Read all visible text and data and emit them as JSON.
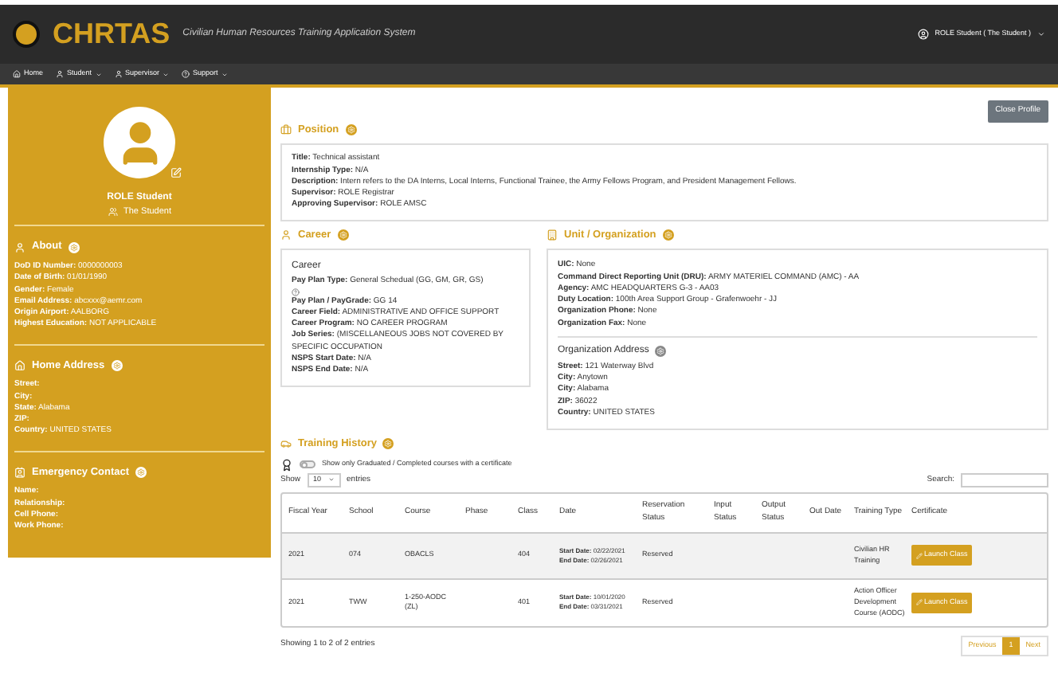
{
  "header": {
    "logo": "CHRTAS",
    "subtitle": "Civilian Human Resources Training Application System",
    "user": "ROLE Student ( The Student )"
  },
  "nav": [
    {
      "label": "Home",
      "kind": "link"
    },
    {
      "label": "Student",
      "kind": "menu"
    },
    {
      "label": "Supervisor",
      "kind": "menu"
    },
    {
      "label": "Support",
      "kind": "menu"
    }
  ],
  "profile": {
    "name": "ROLE Student",
    "role": "The Student"
  },
  "sidebar_sections": [
    {
      "title": "About",
      "fields": [
        [
          "DoD ID Number:",
          "0000000003"
        ],
        [
          "Date of Birth:",
          "01/01/1990"
        ],
        [
          "Gender:",
          "Female"
        ],
        [
          "Email Address:",
          "abcxxx@aemr.com"
        ],
        [
          "Origin Airport:",
          "AALBORG"
        ],
        [
          "Highest Education:",
          "NOT APPLICABLE"
        ]
      ]
    },
    {
      "title": "Home Address",
      "fields": [
        [
          "Street:"
        ],
        [
          "City:"
        ],
        [
          "State:",
          "Alabama"
        ],
        [
          "ZIP:"
        ],
        [
          "Country:",
          "UNITED STATES"
        ]
      ]
    },
    {
      "title": "Emergency Contact",
      "fields": [
        [
          "Name:"
        ],
        [
          "Relationship:"
        ],
        [
          "Cell Phone:"
        ],
        [
          "Work Phone:"
        ]
      ]
    }
  ],
  "close_button": "Close Profile",
  "position": {
    "title": "Position",
    "fields": [
      [
        "Title:",
        "Technical assistant"
      ],
      [
        "Internship Type:",
        "N/A"
      ],
      [
        "Description:",
        "Intern refers to the DA Interns, Local Interns, Functional Trainee, the Army Fellows Program, and President Management Fellows."
      ],
      [
        "Supervisor:",
        "ROLE Registrar"
      ],
      [
        "Approving Supervisor:",
        "ROLE AMSC"
      ]
    ]
  },
  "career": {
    "title": "Career",
    "heading": "Career",
    "fields": [
      [
        "Pay Plan Type:",
        "General Schedual (GG, GM, GR, GS)"
      ],
      [
        "Pay Plan / PayGrade:",
        "GG 14"
      ],
      [
        "Career Field:",
        "ADMINISTRATIVE AND OFFICE SUPPORT"
      ],
      [
        "Career Program:",
        "NO CAREER PROGRAM"
      ],
      [
        "Job Series:",
        "(MISCELLANEOUS JOBS NOT COVERED BY SPECIFIC OCCUPATION"
      ],
      [
        "NSPS Start Date:",
        "N/A"
      ],
      [
        "NSPS End Date:",
        "N/A"
      ]
    ]
  },
  "unit": {
    "title": "Unit / Organization",
    "fields": [
      [
        "UIC:",
        "None"
      ],
      [
        "Command Direct Reporting Unit (DRU):",
        "ARMY MATERIEL COMMAND (AMC) - AA"
      ],
      [
        "Agency:",
        "AMC HEADQUARTERS G-3 - AA03"
      ],
      [
        "Duty Location:",
        "100th Area Support Group - Grafenwoehr - JJ"
      ],
      [
        "Organization Phone:",
        "None"
      ],
      [
        "Organization Fax:",
        "None"
      ]
    ],
    "address_title": "Organization Address",
    "address": [
      [
        "Street:",
        "121 Waterway Blvd"
      ],
      [
        "City:",
        "Anytown"
      ],
      [
        "City:",
        "Alabama"
      ],
      [
        "ZIP:",
        "36022"
      ],
      [
        "Country:",
        "UNITED STATES"
      ]
    ]
  },
  "training": {
    "title": "Training History",
    "filter": {
      "label": "Show only Graduated / Completed courses with a certificate",
      "on": false
    },
    "show": "Show",
    "page_size": "10",
    "entries": "entries",
    "search_label": "Search:",
    "columns": [
      "Fiscal Year",
      "School",
      "Course",
      "Phase",
      "Class",
      "Date",
      "Reservation Status",
      "Input Status",
      "Output Status",
      "Out Date",
      "Training Type",
      "Certificate"
    ],
    "rows": [
      {
        "year": "2021",
        "school": "074",
        "course": "OBACLS",
        "class": "404",
        "start_label": "Start Date:",
        "start": "02/22/2021",
        "end_label": "End Date:",
        "end": "02/26/2021",
        "reservation": "Reserved",
        "training_type": "Civilian HR Training",
        "action": "Launch Class"
      },
      {
        "year": "2021",
        "school": "TWW",
        "course": "1-250-AODC (ZL)",
        "class": "401",
        "start_label": "Start Date:",
        "start": "10/01/2020",
        "end_label": "End Date:",
        "end": "03/31/2021",
        "reservation": "Reserved",
        "training_type": "Action Officer Development Course (AODC)",
        "action": "Launch Class"
      }
    ],
    "summary": "Showing 1 to 2 of 2 entries",
    "pages": [
      {
        "label": "Previous",
        "selected": false
      },
      {
        "label": "1",
        "selected": true
      },
      {
        "label": "Next",
        "selected": false
      }
    ]
  }
}
